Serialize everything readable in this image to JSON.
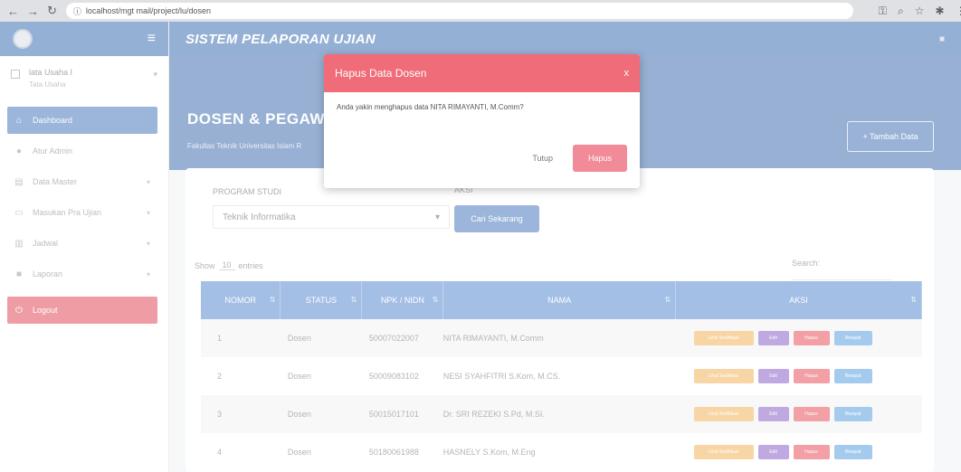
{
  "browser": {
    "url": "localhost/mgt mail/project/lu/dosen"
  },
  "sidebar": {
    "user_name": "lata Usaha I",
    "user_sub": "Tata Usaha",
    "items": [
      {
        "label": "Dashboard",
        "icon": "home-icon"
      },
      {
        "label": "Atur Admin",
        "icon": "user-icon"
      },
      {
        "label": "Data Master",
        "icon": "list-icon"
      },
      {
        "label": "Masukan Pra Ujian",
        "icon": "monitor-icon"
      },
      {
        "label": "Jadwal",
        "icon": "grid-icon"
      },
      {
        "label": "Laporan",
        "icon": "file-icon"
      }
    ],
    "logout_label": "Logout"
  },
  "header": {
    "title": "SISTEM PELAPORAN UJIAN"
  },
  "banner": {
    "title": "DOSEN & PEGAW",
    "subtitle": "Fakultas Teknik Universitas Islam R",
    "add_label": "+ Tambah Data"
  },
  "filters": {
    "program_label": "PROGRAM STUDI",
    "program_value": "Teknik Informatika",
    "aksi_label": "AKSI",
    "search_button": "Cari Sekarang"
  },
  "table": {
    "show_prefix": "Show",
    "show_value": "10",
    "show_suffix": "entries",
    "search_label": "Search:",
    "headers": [
      "NOMOR",
      "STATUS",
      "NPK / NIDN",
      "NAMA",
      "AKSI"
    ],
    "rows": [
      {
        "no": "1",
        "status": "Dosen",
        "nip": "50007022007",
        "nama": "NITA RIMAYANTI, M.Comm"
      },
      {
        "no": "2",
        "status": "Dosen",
        "nip": "50009083102",
        "nama": "NESI SYAHFITRI S.Kom, M.CS."
      },
      {
        "no": "3",
        "status": "Dosen",
        "nip": "50015017101",
        "nama": "Dr. SRI REZEKI S.Pd, M.SI."
      },
      {
        "no": "4",
        "status": "Dosen",
        "nip": "50180061988",
        "nama": "HASNELY S.Kom, M.Eng"
      }
    ],
    "actions": [
      "Lihat Sertifikasi",
      "Edit",
      "Hapus",
      "Riwayat"
    ]
  },
  "modal": {
    "title": "Hapus Data Dosen",
    "close_glyph": "x",
    "message": "Anda yakin menghapus data NITA RIMAYANTI, M.Comm?",
    "close_label": "Tutup",
    "delete_label": "Hapus"
  },
  "colors": {
    "primary": "#3f6fb3",
    "danger": "#ef6c78",
    "table_header": "#5a8ad0"
  }
}
